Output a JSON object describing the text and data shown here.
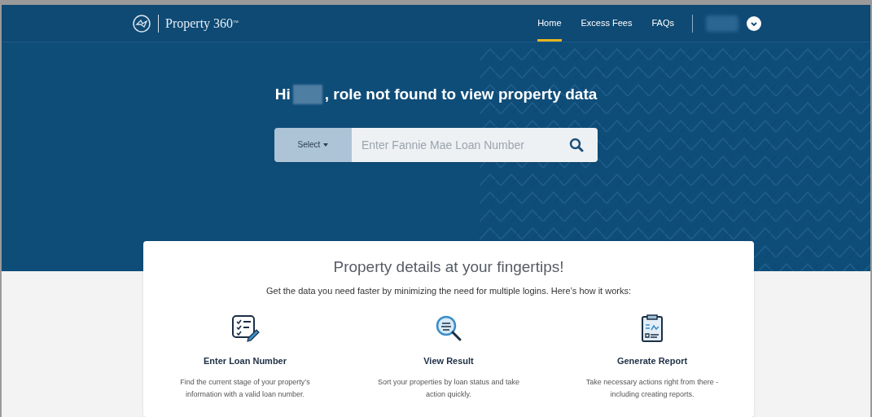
{
  "header": {
    "brand": "Property 360",
    "brand_mark": "™",
    "nav": [
      {
        "label": "Home",
        "selected": true
      },
      {
        "label": "Excess Fees",
        "selected": false
      },
      {
        "label": "FAQs",
        "selected": false
      }
    ]
  },
  "hero": {
    "greeting_before": "Hi",
    "greeting_after": ", role not found to view property data",
    "search": {
      "select_label": "Select",
      "placeholder": "Enter Fannie Mae Loan Number"
    }
  },
  "card": {
    "title": "Property details at your fingertips!",
    "subtitle": "Get the data you need faster by minimizing the need for multiple logins. Here’s how it works:",
    "steps": [
      {
        "kind": "checklist",
        "title": "Enter Loan Number",
        "text": "Find the current stage of your property’s information with a valid loan number."
      },
      {
        "kind": "magnifier",
        "title": "View Result",
        "text": "Sort your properties by loan status and take action quickly."
      },
      {
        "kind": "clipboard",
        "title": "Generate Report",
        "text": "Take necessary actions right from there - including creating reports."
      }
    ]
  }
}
